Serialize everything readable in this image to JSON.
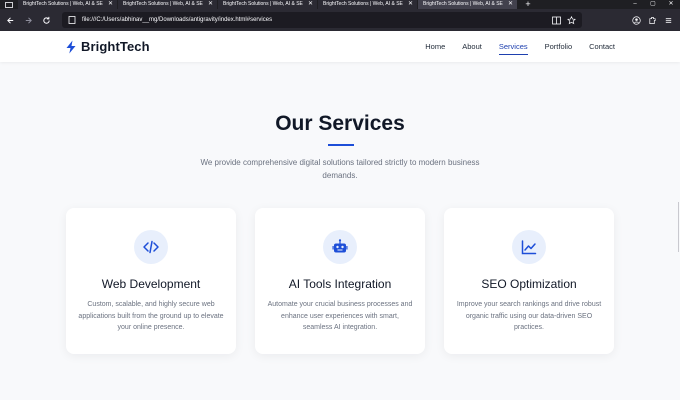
{
  "browser": {
    "tabs": [
      {
        "title": "BrightTech Solutions | Web, AI & SE",
        "active": false
      },
      {
        "title": "BrightTech Solutions | Web, AI & SE",
        "active": false
      },
      {
        "title": "BrightTech Solutions | Web, AI & SE",
        "active": false
      },
      {
        "title": "BrightTech Solutions | Web, AI & SE",
        "active": false
      },
      {
        "title": "BrightTech Solutions | Web, AI & SE",
        "active": true
      }
    ],
    "tab_close": "✕",
    "new_tab": "+",
    "window_controls": [
      "–",
      "▢",
      "✕"
    ],
    "url": "file:///C:/Users/abhinav__mg/Downloads/antigravity/index.html#services"
  },
  "site": {
    "logo": "BrightTech",
    "accent": "#1d4ed8",
    "nav": [
      {
        "label": "Home",
        "active": false
      },
      {
        "label": "About",
        "active": false
      },
      {
        "label": "Services",
        "active": true
      },
      {
        "label": "Portfolio",
        "active": false
      },
      {
        "label": "Contact",
        "active": false
      }
    ]
  },
  "services": {
    "title": "Our Services",
    "subtitle": "We provide comprehensive digital solutions tailored strictly to modern business demands.",
    "cards": [
      {
        "icon": "code-icon",
        "title": "Web Development",
        "description": "Custom, scalable, and highly secure web applications built from the ground up to elevate your online presence."
      },
      {
        "icon": "robot-icon",
        "title": "AI Tools Integration",
        "description": "Automate your crucial business processes and enhance user experiences with smart, seamless AI integration."
      },
      {
        "icon": "chart-line-icon",
        "title": "SEO Optimization",
        "description": "Improve your search rankings and drive robust organic traffic using our data-driven SEO practices."
      }
    ]
  }
}
